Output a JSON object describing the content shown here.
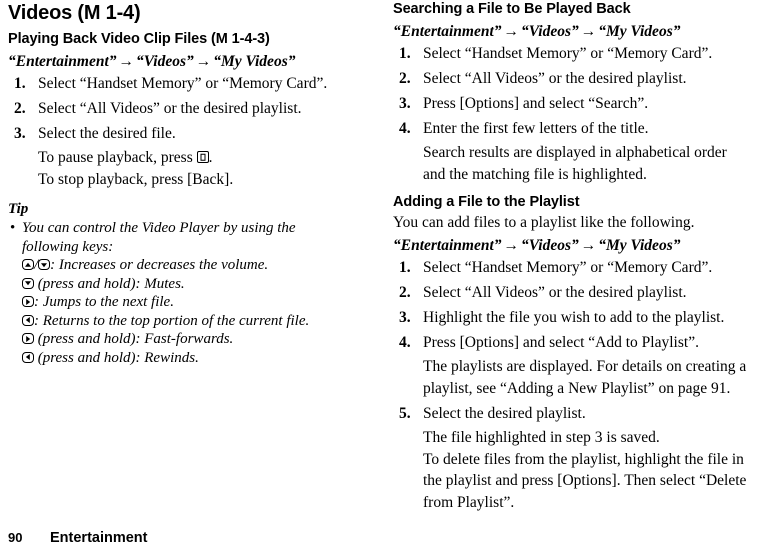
{
  "page": {
    "chapter_title": "Videos (M 1-4)",
    "footer_page_number": "90",
    "footer_chapter": "Entertainment"
  },
  "left_column": {
    "section_heading": "Playing Back Video Clip Files (M 1-4-3)",
    "nav_path": {
      "part1": "“Entertainment”",
      "arrow1": "→",
      "part2": "“Videos”",
      "arrow2": "→",
      "part3": "“My Videos”"
    },
    "steps": [
      {
        "num": "1.",
        "text": "Select “Handset Memory” or “Memory Card”."
      },
      {
        "num": "2.",
        "text": "Select “All Videos” or the desired playlist."
      },
      {
        "num": "3.",
        "text": "Select the desired file."
      }
    ],
    "pause_note_before": "To pause playback, press ",
    "pause_note_after": ".",
    "stop_note": "To stop playback, press [Back].",
    "tip_label": "Tip",
    "tip_bullet": "•",
    "tip_text_line1": "You can control the Video Player by using the",
    "tip_text_line2": "following keys:",
    "key_lines": [
      {
        "icons": [
          "up",
          "down"
        ],
        "separator": "/",
        "text": ": Increases or decreases the volume."
      },
      {
        "icons": [
          "down"
        ],
        "separator": "",
        "text": " (press and hold): Mutes."
      },
      {
        "icons": [
          "right"
        ],
        "separator": "",
        "text": ": Jumps to the next file."
      },
      {
        "icons": [
          "left"
        ],
        "separator": "",
        "text": ": Returns to the top portion of the current file."
      },
      {
        "icons": [
          "right"
        ],
        "separator": "",
        "text": " (press and hold): Fast-forwards."
      },
      {
        "icons": [
          "left"
        ],
        "separator": "",
        "text": " (press and hold): Rewinds."
      }
    ]
  },
  "right_column": {
    "section1_heading": "Searching a File to Be Played Back",
    "section1_nav_path": {
      "part1": "“Entertainment”",
      "arrow1": "→",
      "part2": "“Videos”",
      "arrow2": "→",
      "part3": "“My Videos”"
    },
    "section1_steps": [
      {
        "num": "1.",
        "text": "Select “Handset Memory” or “Memory Card”."
      },
      {
        "num": "2.",
        "text": "Select “All Videos” or the desired playlist."
      },
      {
        "num": "3.",
        "text": "Press [Options] and select “Search”."
      },
      {
        "num": "4.",
        "text": "Enter the first few letters of the title."
      }
    ],
    "section1_note_line1": "Search results are displayed in alphabetical order",
    "section1_note_line2": "and the matching file is highlighted.",
    "section2_heading": "Adding a File to the Playlist",
    "section2_intro": "You can add files to a playlist like the following.",
    "section2_nav_path": {
      "part1": "“Entertainment”",
      "arrow1": "→",
      "part2": "“Videos”",
      "arrow2": "→",
      "part3": "“My Videos”"
    },
    "section2_steps": [
      {
        "num": "1.",
        "text": "Select “Handset Memory” or “Memory Card”."
      },
      {
        "num": "2.",
        "text": "Select “All Videos” or the desired playlist."
      },
      {
        "num": "3.",
        "text": "Highlight the file you wish to add to the playlist."
      },
      {
        "num": "4.",
        "text": "Press [Options] and select “Add to Playlist”."
      }
    ],
    "section2_note4_line1": "The playlists are displayed. For details on creating a",
    "section2_note4_line2": "playlist, see “Adding a New Playlist” on page 91.",
    "section2_step5": {
      "num": "5.",
      "text": "Select the desired playlist."
    },
    "section2_note5_line1": "The file highlighted in step 3 is saved.",
    "section2_note5_line2": "To delete files from the playlist, highlight the file in",
    "section2_note5_line3": "the playlist and press [Options]. Then select “Delete",
    "section2_note5_line4": "from Playlist”."
  }
}
